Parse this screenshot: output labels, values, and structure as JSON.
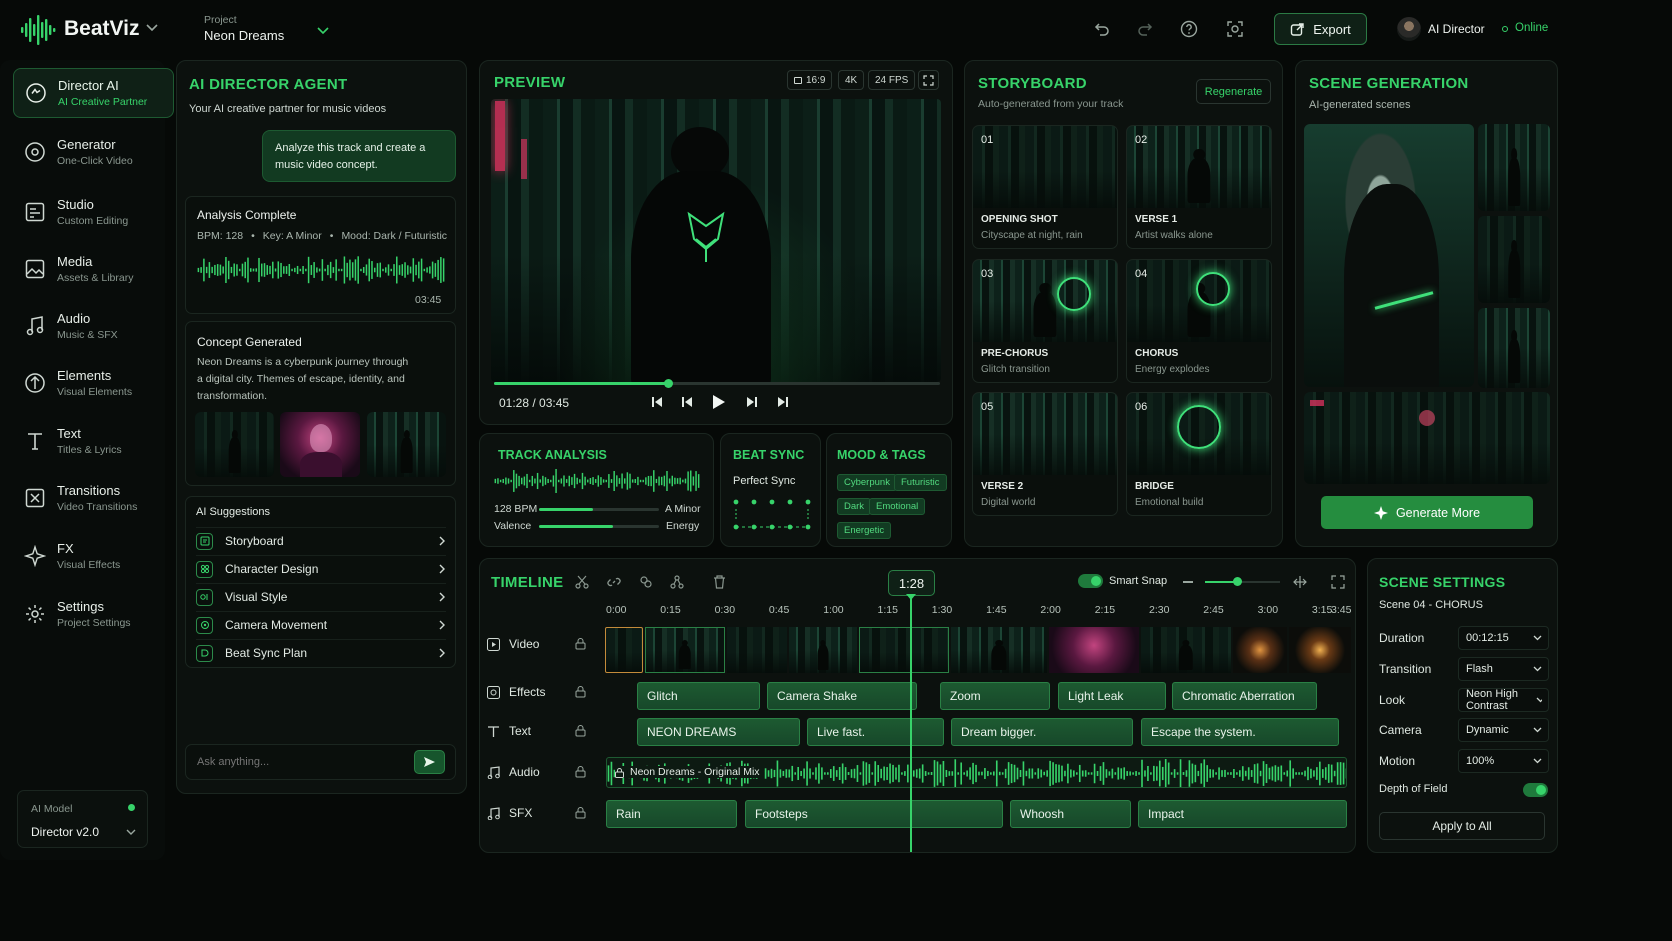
{
  "app": {
    "name": "BeatViz"
  },
  "project": {
    "label": "Project",
    "name": "Neon Dreams"
  },
  "topbar": {
    "export_label": "Export",
    "user_name": "AI Director",
    "status": "Online"
  },
  "sidebar": {
    "items": [
      {
        "title": "Director AI",
        "subtitle": "AI Creative Partner"
      },
      {
        "title": "Generator",
        "subtitle": "One-Click Video"
      },
      {
        "title": "Studio",
        "subtitle": "Custom Editing"
      },
      {
        "title": "Media",
        "subtitle": "Assets & Library"
      },
      {
        "title": "Audio",
        "subtitle": "Music & SFX"
      },
      {
        "title": "Elements",
        "subtitle": "Visual Elements"
      },
      {
        "title": "Text",
        "subtitle": "Titles & Lyrics"
      },
      {
        "title": "Transitions",
        "subtitle": "Video Transitions"
      },
      {
        "title": "FX",
        "subtitle": "Visual Effects"
      },
      {
        "title": "Settings",
        "subtitle": "Project Settings"
      }
    ],
    "model_label": "AI Model",
    "model_value": "Director v2.0"
  },
  "agent": {
    "title": "AI DIRECTOR AGENT",
    "subtitle": "Your AI creative partner for music videos",
    "user_message": "Analyze this track and create a music video concept.",
    "analysis": {
      "title": "Analysis Complete",
      "bpm": "BPM: 128",
      "key": "Key: A Minor",
      "mood": "Mood: Dark / Futuristic",
      "duration": "03:45"
    },
    "concept": {
      "title": "Concept Generated",
      "text": "Neon Dreams is a cyberpunk journey through a digital city. Themes of escape, identity, and transformation."
    },
    "suggestions_title": "AI Suggestions",
    "suggestions": [
      "Storyboard",
      "Character Design",
      "Visual Style",
      "Camera Movement",
      "Beat Sync Plan"
    ],
    "input_placeholder": "Ask anything..."
  },
  "preview": {
    "title": "PREVIEW",
    "ratio": "16:9",
    "resolution": "4K",
    "fps": "24 FPS",
    "time": "01:28 / 03:45",
    "progress": 0.39
  },
  "track_analysis": {
    "title": "TRACK ANALYSIS",
    "bpm": "128 BPM",
    "key": "A Minor",
    "valence_label": "Valence",
    "energy_label": "Energy",
    "valence": 0.45,
    "energy": 0.62
  },
  "beat_sync": {
    "title": "BEAT SYNC",
    "status": "Perfect Sync"
  },
  "mood": {
    "title": "MOOD & TAGS",
    "tags": [
      "Cyberpunk",
      "Futuristic",
      "Dark",
      "Emotional",
      "Energetic"
    ]
  },
  "storyboard": {
    "title": "STORYBOARD",
    "subtitle": "Auto-generated from your track",
    "regenerate": "Regenerate",
    "cards": [
      {
        "num": "01",
        "title": "OPENING SHOT",
        "desc": "Cityscape at night, rain"
      },
      {
        "num": "02",
        "title": "VERSE 1",
        "desc": "Artist walks alone"
      },
      {
        "num": "03",
        "title": "PRE-CHORUS",
        "desc": "Glitch transition"
      },
      {
        "num": "04",
        "title": "CHORUS",
        "desc": "Energy explodes"
      },
      {
        "num": "05",
        "title": "VERSE 2",
        "desc": "Digital world"
      },
      {
        "num": "06",
        "title": "BRIDGE",
        "desc": "Emotional build"
      }
    ]
  },
  "scene_gen": {
    "title": "SCENE GENERATION",
    "subtitle": "AI-generated scenes",
    "button": "Generate More"
  },
  "timeline": {
    "title": "TIMELINE",
    "playhead": "1:28",
    "smart_snap": "Smart Snap",
    "ticks": [
      "0:00",
      "0:15",
      "0:30",
      "0:45",
      "1:00",
      "1:15",
      "1:30",
      "1:45",
      "2:00",
      "2:15",
      "2:30",
      "2:45",
      "3:00",
      "3:15",
      "3:45"
    ],
    "tracks": [
      "Video",
      "Effects",
      "Text",
      "Audio",
      "SFX"
    ],
    "effects": [
      "Glitch",
      "Camera Shake",
      "Zoom",
      "Light Leak",
      "Chromatic Aberration"
    ],
    "texts": [
      "NEON DREAMS",
      "Live fast.",
      "Dream bigger.",
      "Escape the system."
    ],
    "audio_clip": "Neon Dreams - Original Mix",
    "sfx": [
      "Rain",
      "Footsteps",
      "Whoosh",
      "Impact"
    ]
  },
  "scene_settings": {
    "title": "SCENE SETTINGS",
    "scene": "Scene 04 - CHORUS",
    "rows": [
      {
        "label": "Duration",
        "value": "00:12:15"
      },
      {
        "label": "Transition",
        "value": "Flash"
      },
      {
        "label": "Look",
        "value": "Neon High Contrast"
      },
      {
        "label": "Camera",
        "value": "Dynamic"
      },
      {
        "label": "Motion",
        "value": "100%"
      }
    ],
    "dof_label": "Depth of Field",
    "apply": "Apply to All"
  },
  "colors": {
    "accent": "#37d36a",
    "panel": "#0c110e",
    "bg": "#060907"
  }
}
